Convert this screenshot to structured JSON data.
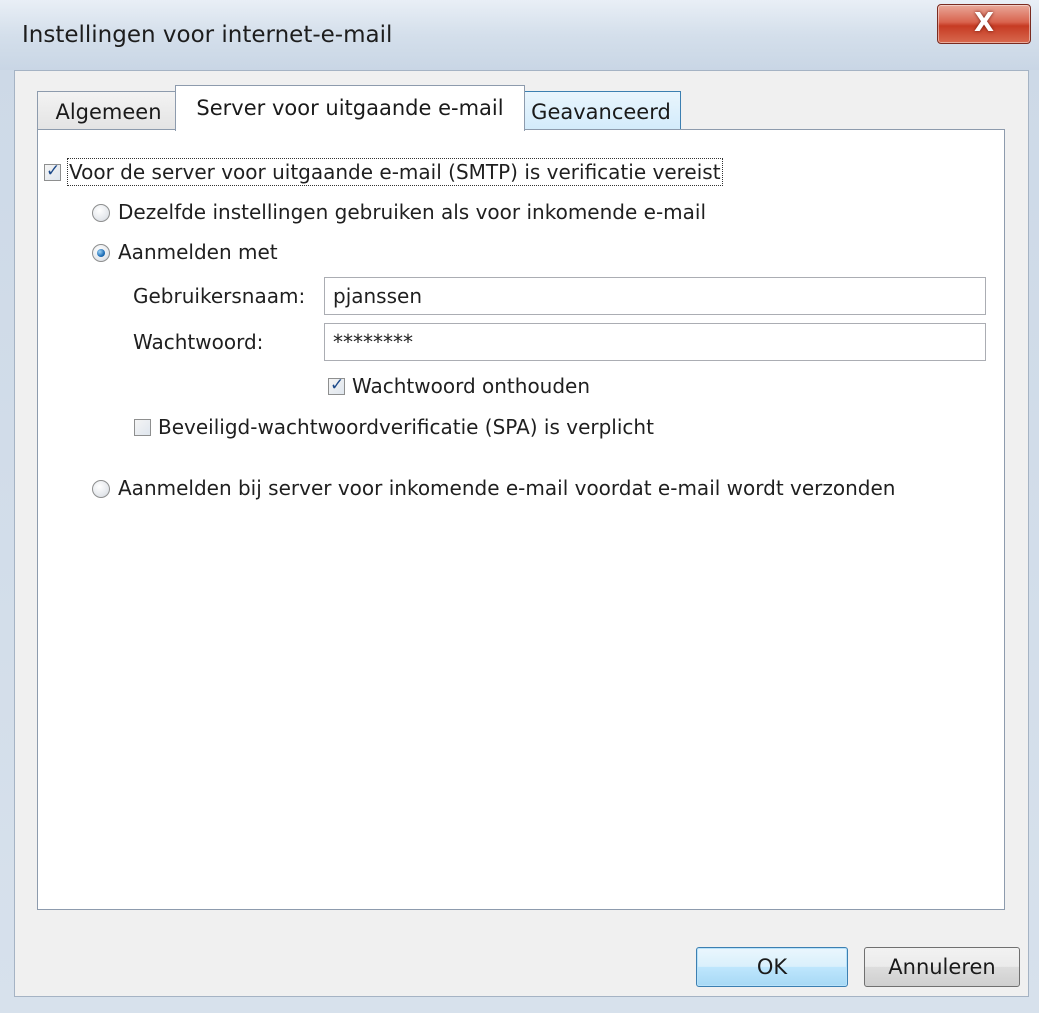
{
  "window": {
    "title": "Instellingen voor internet-e-mail",
    "close_glyph": "X"
  },
  "tabs": [
    {
      "label": "Algemeen"
    },
    {
      "label": "Server voor uitgaande e-mail"
    },
    {
      "label": "Geavanceerd"
    }
  ],
  "smtp_auth": {
    "checkbox_label": "Voor de server voor uitgaande e-mail (SMTP) is verificatie vereist",
    "checked": true
  },
  "options": {
    "same_settings_label": "Dezelfde instellingen gebruiken als voor inkomende e-mail",
    "login_with_label": "Aanmelden met",
    "login_incoming_label": "Aanmelden bij server voor inkomende e-mail voordat e-mail wordt verzonden"
  },
  "credentials": {
    "username_label": "Gebruikersnaam:",
    "username_value": "pjanssen",
    "password_label": "Wachtwoord:",
    "password_value": "********",
    "remember_label": "Wachtwoord onthouden",
    "remember_checked": true,
    "spa_label": "Beveiligd-wachtwoordverificatie (SPA) is verplicht",
    "spa_checked": false
  },
  "buttons": {
    "ok_label": "OK",
    "cancel_label": "Annuleren"
  }
}
